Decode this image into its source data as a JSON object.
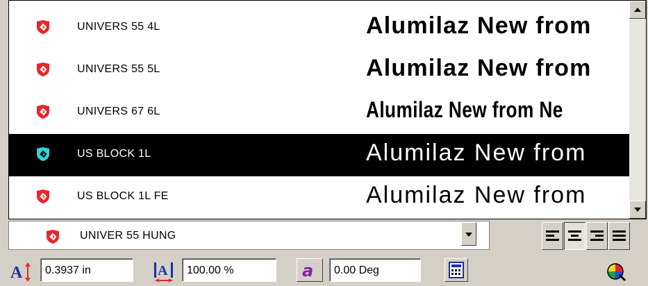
{
  "font_list": {
    "items": [
      {
        "name": "UNIVERS 55 4L",
        "sample": "Alumilaz  New  from",
        "style": "bold",
        "selected": false
      },
      {
        "name": "UNIVERS 55 5L",
        "sample": "Alumilaz  New  from",
        "style": "bold",
        "selected": false
      },
      {
        "name": "UNIVERS 67 6L",
        "sample": "Alumilaz New from Ne",
        "style": "condensed",
        "selected": false
      },
      {
        "name": "US BLOCK 1L",
        "sample": "Alumilaz  New  from",
        "style": "thin",
        "selected": true
      },
      {
        "name": "US BLOCK 1L FE",
        "sample": "Alumilaz  New  from",
        "style": "thin",
        "selected": false
      }
    ]
  },
  "font_combo": {
    "value": "UNIVER 55 HUNG"
  },
  "toolbar": {
    "height_value": "0.3937 in",
    "width_value": "100.00 %",
    "slant_value": "0.00 Deg"
  },
  "icons": {
    "font_item": "font-shield-icon",
    "colors": {
      "red": "#e8262a",
      "cyan": "#2fd6d6",
      "selected_bg": "#000000",
      "face": "#d4d0c8"
    }
  }
}
